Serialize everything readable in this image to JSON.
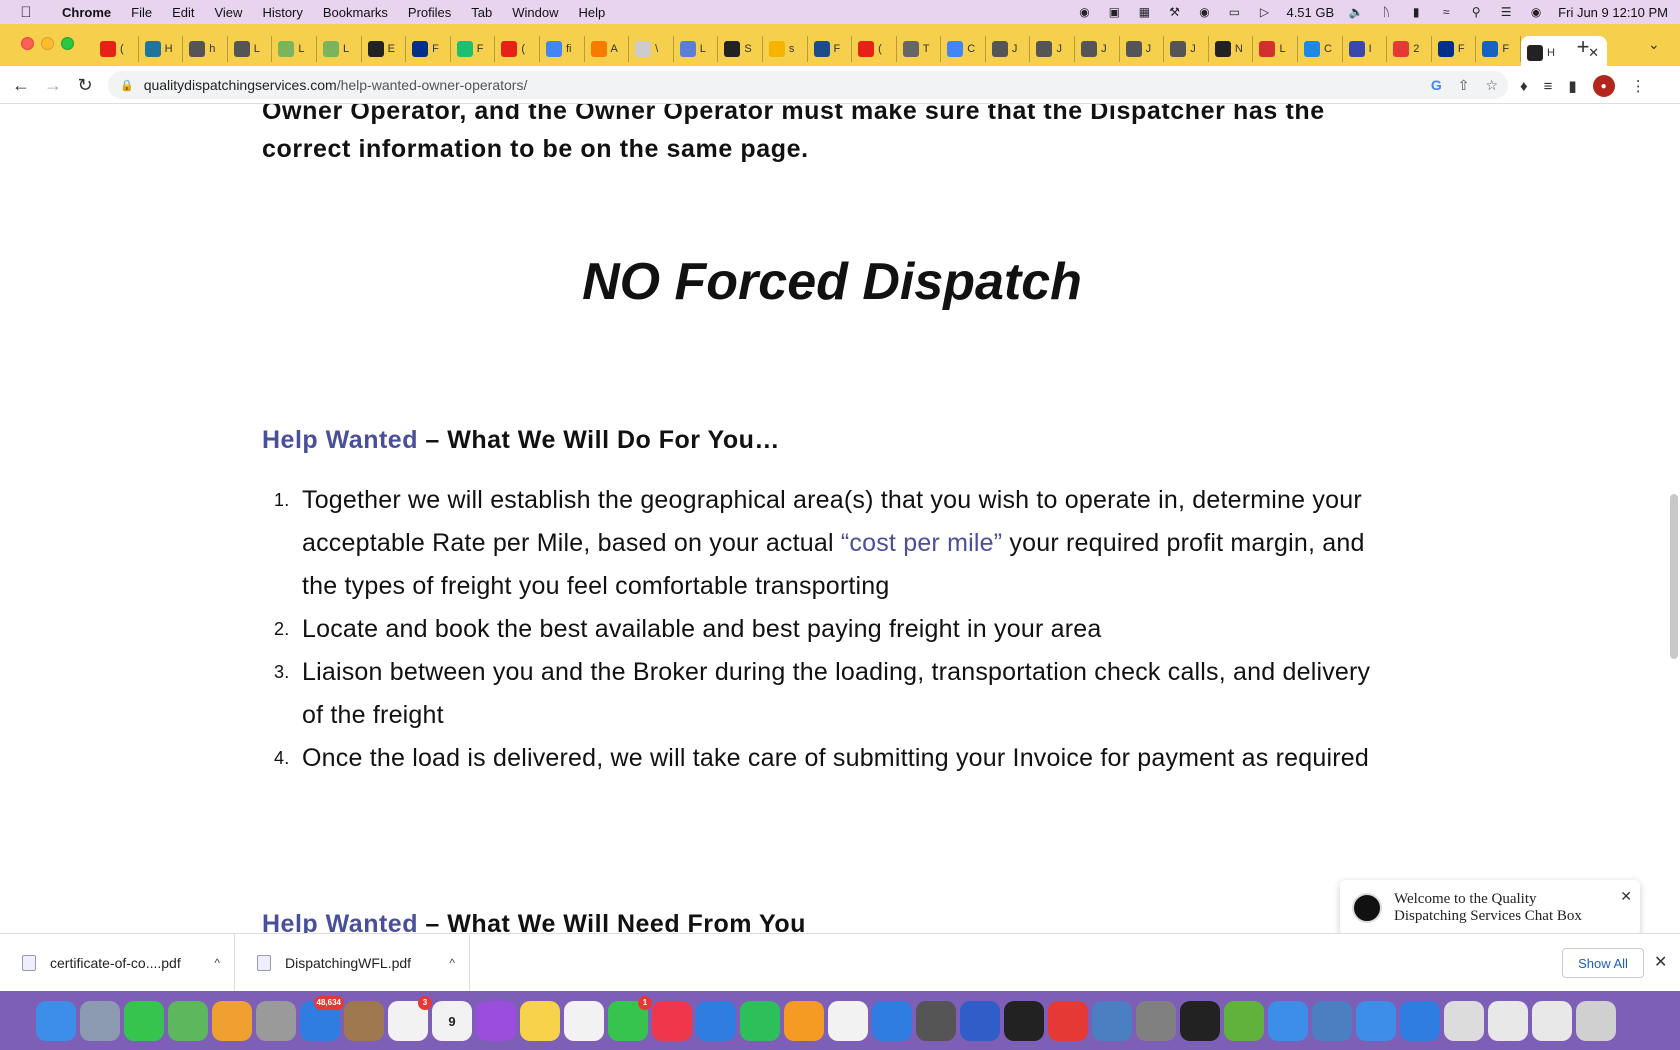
{
  "menubar": {
    "app": "Chrome",
    "items": [
      "File",
      "Edit",
      "View",
      "History",
      "Bookmarks",
      "Profiles",
      "Tab",
      "Window",
      "Help"
    ],
    "memory": "4.51 GB",
    "datetime": "Fri Jun 9  12:10 PM"
  },
  "tabs": {
    "inactive": [
      {
        "label": "(",
        "icon": "youtube-icon",
        "color": "#e62117"
      },
      {
        "label": "H",
        "icon": "wordpress-icon",
        "color": "#21759b"
      },
      {
        "label": "h",
        "icon": "globe-icon",
        "color": "#555555"
      },
      {
        "label": "L",
        "icon": "globe-icon",
        "color": "#555555"
      },
      {
        "label": "L",
        "icon": "shopify-icon",
        "color": "#7ab55c"
      },
      {
        "label": "L",
        "icon": "shopify-icon",
        "color": "#7ab55c"
      },
      {
        "label": "E",
        "icon": "shopify-icon",
        "color": "#222222"
      },
      {
        "label": "F",
        "icon": "paypal-icon",
        "color": "#003087"
      },
      {
        "label": "F",
        "icon": "fiverr-icon",
        "color": "#1dbf73"
      },
      {
        "label": "(",
        "icon": "youtube-icon",
        "color": "#e62117"
      },
      {
        "label": "fi",
        "icon": "google-icon",
        "color": "#4285f4"
      },
      {
        "label": "A",
        "icon": "ads-icon",
        "color": "#f57c00"
      },
      {
        "label": "\\",
        "icon": "blank-icon",
        "color": "#cccccc"
      },
      {
        "label": "L",
        "icon": "doc-icon",
        "color": "#5b7fd6"
      },
      {
        "label": "S",
        "icon": "globe-icon",
        "color": "#222222"
      },
      {
        "label": "s",
        "icon": "slides-icon",
        "color": "#f4b400"
      },
      {
        "label": "F",
        "icon": "globe-icon",
        "color": "#1c4c8a"
      },
      {
        "label": "(",
        "icon": "youtube-icon",
        "color": "#e62117"
      },
      {
        "label": "T",
        "icon": "shield-icon",
        "color": "#666666"
      },
      {
        "label": "C",
        "icon": "google-icon",
        "color": "#4285f4"
      },
      {
        "label": "J",
        "icon": "info-icon",
        "color": "#555555"
      },
      {
        "label": "J",
        "icon": "info-icon",
        "color": "#555555"
      },
      {
        "label": "J",
        "icon": "info-icon",
        "color": "#555555"
      },
      {
        "label": "J",
        "icon": "info-icon",
        "color": "#555555"
      },
      {
        "label": "J",
        "icon": "info-icon",
        "color": "#555555"
      },
      {
        "label": "N",
        "icon": "info-icon",
        "color": "#222222"
      },
      {
        "label": "L",
        "icon": "globe-icon",
        "color": "#d32f2f"
      },
      {
        "label": "C",
        "icon": "globe-icon",
        "color": "#1e88e5"
      },
      {
        "label": "I",
        "icon": "globe-icon",
        "color": "#3949ab"
      },
      {
        "label": "2",
        "icon": "heart-icon",
        "color": "#e53935"
      },
      {
        "label": "F",
        "icon": "paypal-icon",
        "color": "#003087"
      },
      {
        "label": "F",
        "icon": "globe-icon",
        "color": "#1565c0"
      }
    ],
    "active": {
      "label": "H",
      "icon": "quality-dispatching-icon"
    }
  },
  "toolbar": {
    "url_domain": "qualitydispatchingservices.com",
    "url_path": "/help-wanted-owner-operators/"
  },
  "page": {
    "intro": "Owner Operator, and the Owner Operator must make sure that the Dispatcher has the correct information to be on the same page.",
    "headline": "NO Forced Dispatch",
    "section_do": {
      "highlight": "Help Wanted",
      "rest": " – What We Will Do For You…"
    },
    "items": [
      {
        "num": "1.",
        "before": "Together we will establish the geographical area(s) that you wish to operate in, determine your acceptable Rate per Mile, based on your actual ",
        "link": "“cost per mile”",
        "after": " your required profit margin, and the types of freight you feel comfortable transporting"
      },
      {
        "num": "2.",
        "before": "Locate and book the best available and best paying freight in your area",
        "link": "",
        "after": ""
      },
      {
        "num": "3.",
        "before": "Liaison between you and the Broker during the loading, transportation check calls, and delivery of the freight",
        "link": "",
        "after": ""
      },
      {
        "num": "4.",
        "before": "Once the load is delivered, we will take care of submitting your Invoice for payment as required",
        "link": "",
        "after": ""
      }
    ],
    "section_need": {
      "highlight": "Help Wanted",
      "rest": " – What We Will Need From You"
    }
  },
  "chat": {
    "welcome": "Welcome to the Quality Dispatching Services Chat Box"
  },
  "downloads": {
    "items": [
      "certificate-of-co....pdf",
      "DispatchingWFL.pdf"
    ],
    "show_all": "Show All"
  },
  "dock": {
    "icons": [
      {
        "name": "finder-icon",
        "color": "#3d8ee8"
      },
      {
        "name": "launchpad-icon",
        "color": "#8c9bb0"
      },
      {
        "name": "messages-icon",
        "color": "#36c44f"
      },
      {
        "name": "maps-icon",
        "color": "#5db75d"
      },
      {
        "name": "photos-icon",
        "color": "#f0a030"
      },
      {
        "name": "help-icon",
        "color": "#9a9a9a"
      },
      {
        "name": "mail-icon",
        "color": "#2f7de1",
        "badge": "48,634"
      },
      {
        "name": "contacts-icon",
        "color": "#a07850"
      },
      {
        "name": "reminders-icon",
        "color": "#f2f2f2",
        "badge": "3"
      },
      {
        "name": "calendar-icon",
        "color": "#f2f2f2",
        "label": "9"
      },
      {
        "name": "podcasts-icon",
        "color": "#9b4ddb"
      },
      {
        "name": "notes-icon",
        "color": "#f7d24a"
      },
      {
        "name": "news-icon",
        "color": "#f2f2f2"
      },
      {
        "name": "facetime-icon",
        "color": "#36c44f",
        "badge": "1"
      },
      {
        "name": "music-icon",
        "color": "#f0364a"
      },
      {
        "name": "keynote-icon",
        "color": "#2f7de1"
      },
      {
        "name": "numbers-icon",
        "color": "#2fbf5a"
      },
      {
        "name": "pages-icon",
        "color": "#f59a23"
      },
      {
        "name": "chrome-icon",
        "color": "#f2f2f2"
      },
      {
        "name": "app-store-icon",
        "color": "#2f7de1"
      },
      {
        "name": "sequel-icon",
        "color": "#555555"
      },
      {
        "name": "cyberduck-icon",
        "color": "#2f5ec9"
      },
      {
        "name": "terminal-icon",
        "color": "#222222"
      },
      {
        "name": "p-app-icon",
        "color": "#e53935"
      },
      {
        "name": "virtualbox-icon",
        "color": "#4a7fc1"
      },
      {
        "name": "system-preferences-icon",
        "color": "#808080"
      },
      {
        "name": "apple-tv-icon",
        "color": "#222222"
      },
      {
        "name": "utorrent-icon",
        "color": "#5fb33c"
      },
      {
        "name": "transmit-icon",
        "color": "#3d8ee8"
      },
      {
        "name": "virtualbox-vm-icon",
        "color": "#4a7fc1"
      },
      {
        "name": "folder-icon",
        "color": "#3d8ee8"
      },
      {
        "name": "app-store-folder-icon",
        "color": "#2f7de1"
      },
      {
        "name": "screenshot-icon",
        "color": "#dcdcdc"
      },
      {
        "name": "documents-icon",
        "color": "#e8e8e8"
      },
      {
        "name": "downloads-folder-icon",
        "color": "#e8e8e8"
      },
      {
        "name": "trash-icon",
        "color": "#d0d0d0"
      }
    ]
  }
}
